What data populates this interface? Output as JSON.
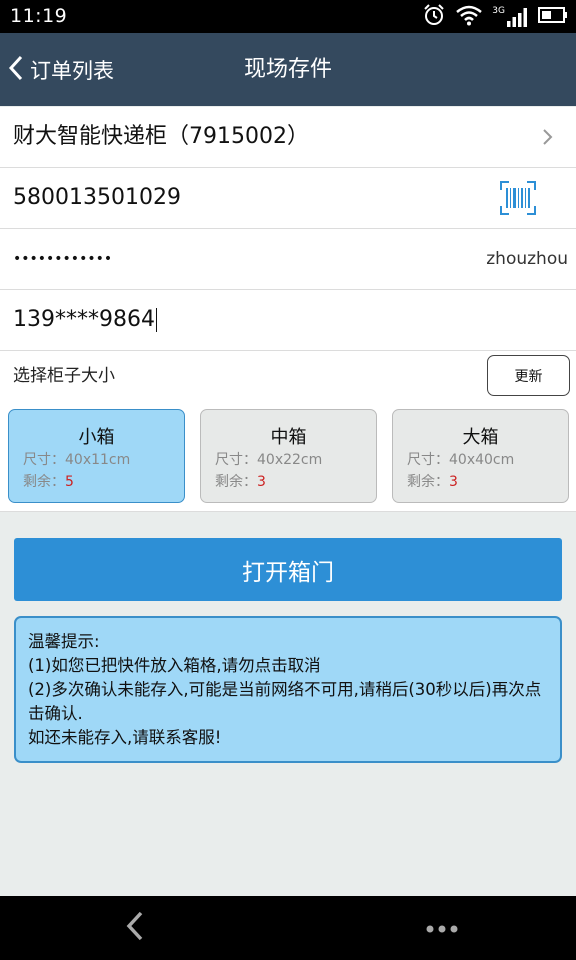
{
  "status_bar": {
    "time": "11:19",
    "network_label": "3G"
  },
  "nav": {
    "back_label": "订单列表",
    "title": "现场存件"
  },
  "form": {
    "cabinet_label": "财大智能快递柜（7915002）",
    "tracking_number": "580013501029",
    "password_masked": "••••••••••••",
    "username": "zhouzhou",
    "phone": "139****9864"
  },
  "size_selector": {
    "label": "选择柜子大小",
    "refresh_label": "更新",
    "boxes": [
      {
        "name": "小箱",
        "size_label": "尺寸：",
        "size": "40x11cm",
        "remaining_label": "剩余：",
        "remaining": "5",
        "selected": true
      },
      {
        "name": "中箱",
        "size_label": "尺寸：",
        "size": "40x22cm",
        "remaining_label": "剩余：",
        "remaining": "3",
        "selected": false
      },
      {
        "name": "大箱",
        "size_label": "尺寸：",
        "size": "40x40cm",
        "remaining_label": "剩余：",
        "remaining": "3",
        "selected": false
      }
    ]
  },
  "open_button_label": "打开箱门",
  "tip": {
    "title": "温馨提示:",
    "lines": [
      "(1)如您已把快件放入箱格,请勿点击取消",
      "(2)多次确认未能存入,可能是当前网络不可用,请稍后(30秒以后)再次点击确认.",
      "如还未能存入,请联系客服!"
    ]
  },
  "icons": [
    "alarm-icon",
    "wifi-icon",
    "signal-icon",
    "battery-icon",
    "back-chevron-icon",
    "chevron-right-icon",
    "barcode-scan-icon",
    "nav-back-icon",
    "nav-menu-icon"
  ],
  "colors": {
    "nav_bar": "#34495e",
    "primary_button": "#2d8fd6",
    "selected_box": "#9fd8f7",
    "highlight_border": "#3a8fc9",
    "remaining_count": "#cc2222"
  }
}
